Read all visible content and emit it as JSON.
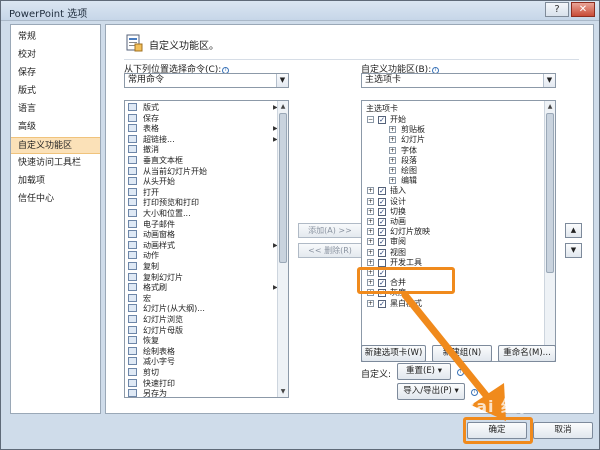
{
  "window": {
    "title": "PowerPoint 选项",
    "help_glyph": "?",
    "close_glyph": "✕"
  },
  "nav": {
    "items": [
      {
        "label": "常规"
      },
      {
        "label": "校对"
      },
      {
        "label": "保存"
      },
      {
        "label": "版式"
      },
      {
        "label": "语言"
      },
      {
        "label": "高级"
      },
      {
        "label": "自定义功能区"
      },
      {
        "label": "快速访问工具栏"
      },
      {
        "label": "加载项"
      },
      {
        "label": "信任中心"
      }
    ],
    "selected": "自定义功能区"
  },
  "header": {
    "text": "自定义功能区。"
  },
  "left_panel": {
    "label": "从下列位置选择命令(C):",
    "combo_value": "常用命令",
    "commands": [
      "版式",
      "保存",
      "表格",
      "超链接...",
      "撤消",
      "垂直文本框",
      "从当前幻灯片开始",
      "从头开始",
      "打开",
      "打印预览和打印",
      "大小和位置...",
      "电子邮件",
      "动画窗格",
      "动画样式",
      "动作",
      "复制",
      "复制幻灯片",
      "格式刷",
      "宏",
      "幻灯片(从大纲)...",
      "幻灯片浏览",
      "幻灯片母版",
      "恢复",
      "绘制表格",
      "减小字号",
      "剪切",
      "快速打印",
      "另存为"
    ],
    "submenu_glyph": "▶"
  },
  "middle": {
    "add_label": "添加(A) >>",
    "remove_label": "<< 删除(R)"
  },
  "right_panel": {
    "label": "自定义功能区(B):",
    "combo_value": "主选项卡",
    "tree_header": "主选项卡",
    "tree": [
      {
        "label": "开始",
        "level": 0,
        "expander": "⊟",
        "checked": true
      },
      {
        "label": "剪贴板",
        "level": 1,
        "expander": "⊞",
        "checked": null
      },
      {
        "label": "幻灯片",
        "level": 1,
        "expander": "⊞",
        "checked": null
      },
      {
        "label": "字体",
        "level": 1,
        "expander": "⊞",
        "checked": null
      },
      {
        "label": "段落",
        "level": 1,
        "expander": "⊞",
        "checked": null
      },
      {
        "label": "绘图",
        "level": 1,
        "expander": "⊞",
        "checked": null
      },
      {
        "label": "编辑",
        "level": 1,
        "expander": "⊞",
        "checked": null
      },
      {
        "label": "插入",
        "level": 0,
        "expander": "⊞",
        "checked": true
      },
      {
        "label": "设计",
        "level": 0,
        "expander": "⊞",
        "checked": true
      },
      {
        "label": "切换",
        "level": 0,
        "expander": "⊞",
        "checked": true
      },
      {
        "label": "动画",
        "level": 0,
        "expander": "⊞",
        "checked": true
      },
      {
        "label": "幻灯片放映",
        "level": 0,
        "expander": "⊞",
        "checked": true
      },
      {
        "label": "审阅",
        "level": 0,
        "expander": "⊞",
        "checked": true
      },
      {
        "label": "视图",
        "level": 0,
        "expander": "⊞",
        "checked": true
      },
      {
        "label": "开发工具",
        "level": 0,
        "expander": "⊞",
        "checked": false
      },
      {
        "label": "",
        "level": 0,
        "expander": "⊞",
        "checked": true
      },
      {
        "label": "合并",
        "level": 0,
        "expander": "⊞",
        "checked": true
      },
      {
        "label": "灰度",
        "level": 0,
        "expander": "⊞",
        "checked": true
      },
      {
        "label": "黑白模式",
        "level": 0,
        "expander": "⊞",
        "checked": true
      }
    ],
    "check_glyph": "✓",
    "new_tab_label": "新建选项卡(W)",
    "new_group_label": "新建组(N)",
    "rename_label": "重命名(M)...",
    "customize_label": "自定义:",
    "reset_label": "重置(E) ▾",
    "import_export_label": "导入/导出(P) ▾",
    "move_up_glyph": "▲",
    "move_down_glyph": "▼"
  },
  "footer": {
    "ok_label": "确定",
    "cancel_label": "取消"
  },
  "info_glyph": "i",
  "watermark": "Bai 经验",
  "colors": {
    "highlight": "#f08a1c",
    "nav_selected": "#fbe1b8"
  }
}
